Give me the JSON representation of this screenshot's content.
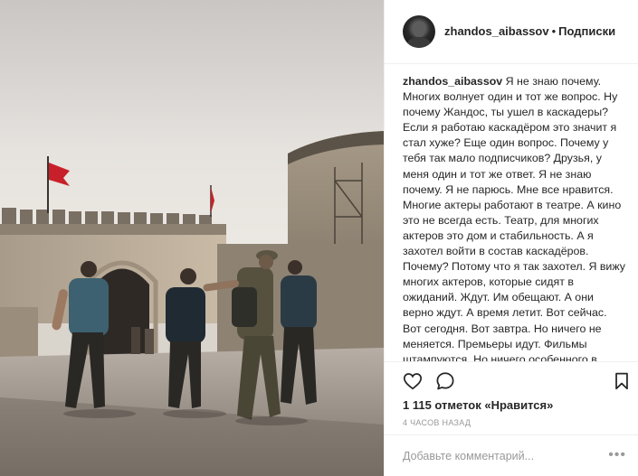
{
  "header": {
    "username": "zhandos_aibassov",
    "separator": "•",
    "follow_label": "Подписки"
  },
  "caption": {
    "username": "zhandos_aibassov",
    "text": "Я не знаю почему. Многих волнует один и тот же вопрос. Ну почему Жандос, ты ушел в каскадеры? Если я работаю каскадёром это значит я стал хуже? Еще один вопрос. Почему у тебя так мало подписчиков? Друзья, у меня один и тот же ответ. Я не знаю почему. Я не парюсь. Мне все нравится. Многие актеры работают в театре. А кино это не всегда есть. Театр, для многих актеров это дом и стабильность. А я захотел войти в состав каскадёров. Почему? Потому что я так захотел. Я вижу многих актеров, которые сидят в ожиданий. Ждут. Им обещают. А они верно ждут. А время летит. Вот сейчас. Вот сегодня. Вот завтра. Но ничего не меняется. Премьеры идут. Фильмы штампуются. Но ничего особенного в жизни актёра не"
  },
  "actions": {
    "like_icon": "heart-icon",
    "comment_icon": "comment-icon",
    "save_icon": "bookmark-icon"
  },
  "likes": "1 115 отметок «Нравится»",
  "timestamp": "4 часов назад",
  "comment": {
    "placeholder": "Добавьте комментарий...",
    "more_label": "•••"
  },
  "colors": {
    "text": "#262626",
    "muted": "#999999",
    "border": "#efefef",
    "flag": "#c8202a"
  }
}
